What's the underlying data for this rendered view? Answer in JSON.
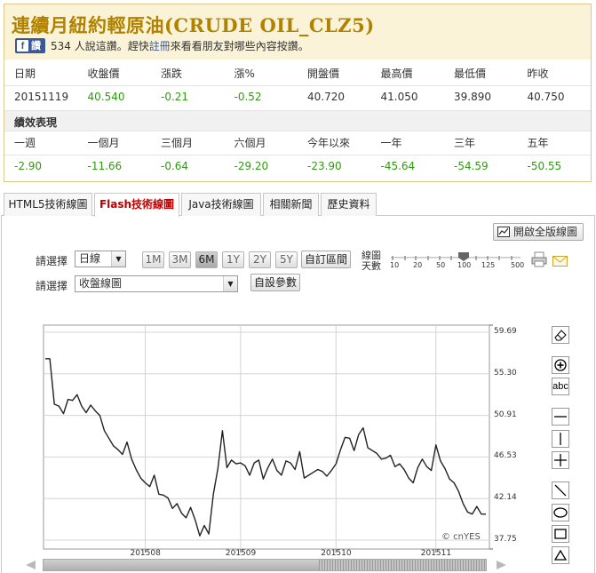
{
  "title": "連續月紐約輕原油(CRUDE OIL_CLZ5)",
  "facebook": {
    "like_label": "讚",
    "logo": "f",
    "count_text": "534 人說這讚。",
    "pre_link": "趕快",
    "link": "註冊",
    "post_link": "來看看朋友對哪些內容按讚。"
  },
  "quote": {
    "headers": [
      "日期",
      "收盤價",
      "漲跌",
      "漲%",
      "開盤價",
      "最高價",
      "最低價",
      "昨收"
    ],
    "values": [
      "20151119",
      "40.540",
      "-0.21",
      "-0.52",
      "40.720",
      "41.050",
      "39.890",
      "40.750"
    ]
  },
  "performance": {
    "title": "績效表現",
    "headers": [
      "一週",
      "一個月",
      "三個月",
      "六個月",
      "今年以來",
      "一年",
      "三年",
      "五年"
    ],
    "values": [
      "-2.90",
      "-11.66",
      "-0.64",
      "-29.20",
      "-23.90",
      "-45.64",
      "-54.59",
      "-50.55"
    ]
  },
  "tabs": [
    "HTML5技術線圖",
    "Flash技術線圖",
    "Java技術線圖",
    "相關新聞",
    "歷史資料"
  ],
  "active_tab": 1,
  "toolbar": {
    "fullscreen_label": "開啟全版線圖",
    "select_label_1": "請選擇",
    "select_label_2": "請選擇",
    "period_select": "日線",
    "chart_type_select": "收盤線圖",
    "ranges": [
      "1M",
      "3M",
      "6M",
      "1Y",
      "2Y",
      "5Y"
    ],
    "active_range": "6M",
    "custom_range_label": "自訂區間",
    "custom_params_label": "自設參數",
    "days_label": "線圖天數",
    "days_ticks": [
      "10",
      "20",
      "50",
      "100",
      "125",
      "500"
    ],
    "days_selected": "100"
  },
  "chart_data": {
    "type": "line",
    "y_ticks": [
      "59.69",
      "55.30",
      "50.91",
      "46.53",
      "42.14",
      "37.75"
    ],
    "ylim": [
      37.75,
      59.69
    ],
    "x_labels": [
      "201508",
      "201509",
      "201510",
      "201511"
    ],
    "x_label_index": [
      22,
      43,
      64,
      86
    ],
    "grid": true,
    "watermark": "© cnYES",
    "series": [
      {
        "values": [
          56.9,
          56.9,
          52.1,
          51.9,
          51.1,
          52.6,
          52.5,
          53.1,
          51.9,
          51.2,
          52.0,
          51.4,
          50.9,
          49.3,
          48.5,
          47.7,
          47.3,
          46.8,
          48.1,
          46.3,
          45.2,
          44.3,
          43.8,
          43.4,
          44.6,
          42.6,
          42.5,
          42.2,
          41.1,
          41.6,
          40.6,
          40.1,
          41.2,
          39.9,
          38.2,
          39.3,
          38.4,
          42.6,
          45.3,
          49.3,
          45.4,
          46.2,
          45.8,
          45.9,
          45.6,
          44.6,
          45.9,
          46.2,
          44.2,
          45.4,
          46.3,
          45.1,
          44.6,
          46.1,
          45.9,
          45.2,
          47.1,
          44.3,
          44.6,
          44.9,
          45.2,
          45.0,
          44.5,
          45.1,
          45.8,
          47.3,
          48.6,
          48.5,
          47.2,
          48.9,
          49.6,
          47.5,
          47.2,
          46.9,
          46.3,
          46.4,
          46.7,
          45.5,
          45.8,
          45.2,
          44.3,
          43.8,
          45.4,
          46.3,
          45.5,
          45.1,
          47.8,
          46.1,
          45.3,
          44.2,
          43.8,
          42.9,
          41.6,
          40.7,
          40.5,
          41.3,
          40.5,
          40.5
        ]
      }
    ]
  },
  "tools": [
    "eraser-icon",
    "zoom-in-icon",
    "text-tool-icon",
    "horizontal-line-icon",
    "vertical-line-icon",
    "crosshair-icon",
    "diagonal-line-icon",
    "ellipse-icon",
    "rectangle-icon",
    "triangle-icon"
  ],
  "tool_text": "abc"
}
